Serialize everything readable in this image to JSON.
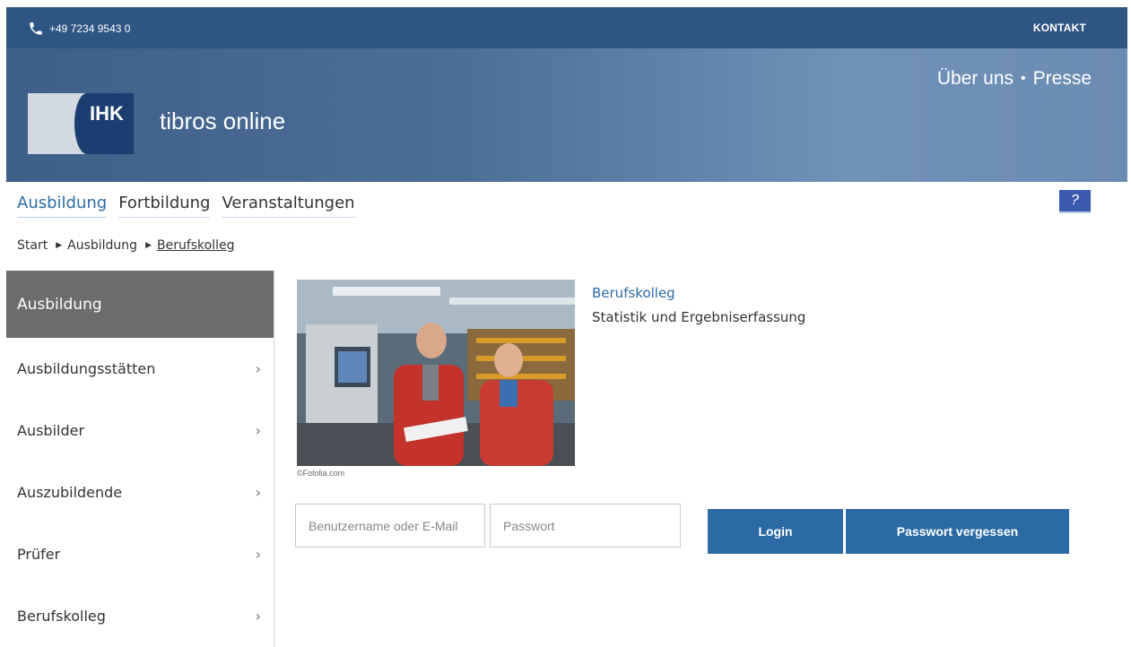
{
  "topbar": {
    "phone": "+49 7234 9543 0",
    "contact": "KONTAKT"
  },
  "banner": {
    "nav": [
      "Über uns",
      "Presse"
    ],
    "logo_abbr": "IHK",
    "logo_text": "tibros online"
  },
  "mainnav": {
    "items": [
      "Ausbildung",
      "Fortbildung",
      "Veranstaltungen"
    ],
    "active": "Ausbildung"
  },
  "help": {
    "label": "?"
  },
  "breadcrumb": [
    "Start",
    "Ausbildung",
    "Berufskolleg"
  ],
  "sidebar": {
    "heading": "Ausbildung",
    "items": [
      "Ausbildungsstätten",
      "Ausbilder",
      "Auszubildende",
      "Prüfer",
      "Berufskolleg"
    ]
  },
  "content": {
    "photo_credit": "©Fotolia.com",
    "title": "Berufskolleg",
    "subtitle": "Statistik und Ergebniserfassung"
  },
  "login": {
    "username_placeholder": "Benutzername oder E-Mail",
    "password_placeholder": "Passwort",
    "login_label": "Login",
    "forgot_label": "Passwort vergessen"
  },
  "colors": {
    "primary": "#2c6aa6",
    "topbar": "#2f5583",
    "sidebar_active": "#6c6c6c"
  }
}
